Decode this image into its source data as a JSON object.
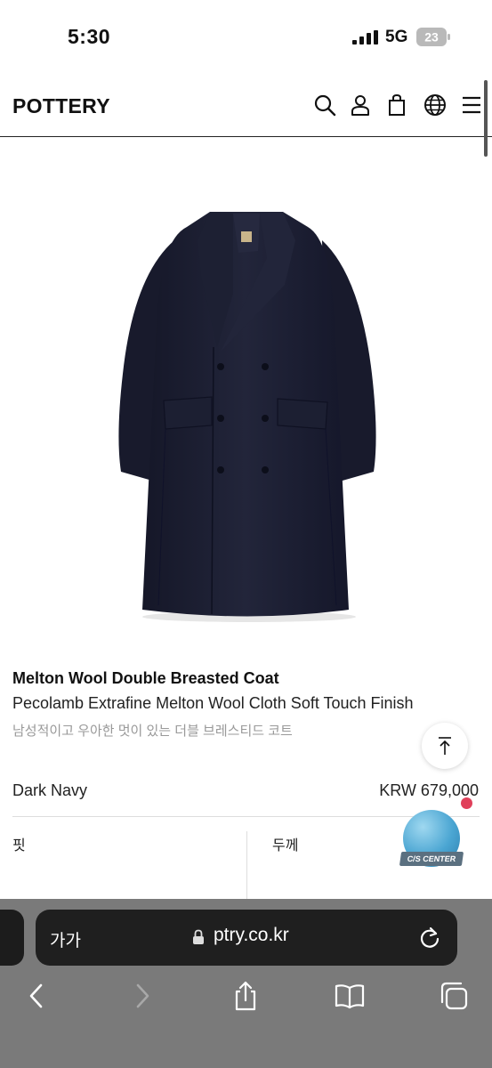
{
  "status_bar": {
    "time": "5:30",
    "network": "5G",
    "battery": "23"
  },
  "header": {
    "logo": "POTTERY",
    "icons": [
      "search-icon",
      "user-icon",
      "bag-icon",
      "globe-icon",
      "menu-icon"
    ]
  },
  "product": {
    "title": "Melton Wool Double Breasted Coat",
    "subtitle": "Pecolamb Extrafine Melton Wool Cloth Soft Touch Finish",
    "description_kr": "남성적이고 우아한 멋이 있는 더블 브레스티드 코트",
    "color": "Dark Navy",
    "price": "KRW 679,000",
    "attributes": {
      "fit_label": "핏",
      "thickness_label": "두께"
    }
  },
  "cs_center": {
    "label": "C/S CENTER"
  },
  "browser": {
    "text_size_label": "가가",
    "url": "ptry.co.kr"
  },
  "colors": {
    "coat": "#1b1d2e",
    "browser_bg": "#7a7a7a",
    "urlbar_bg": "#1f1f1f",
    "cs_blue": "#4aa5d2",
    "notify_dot": "#e0405a"
  }
}
